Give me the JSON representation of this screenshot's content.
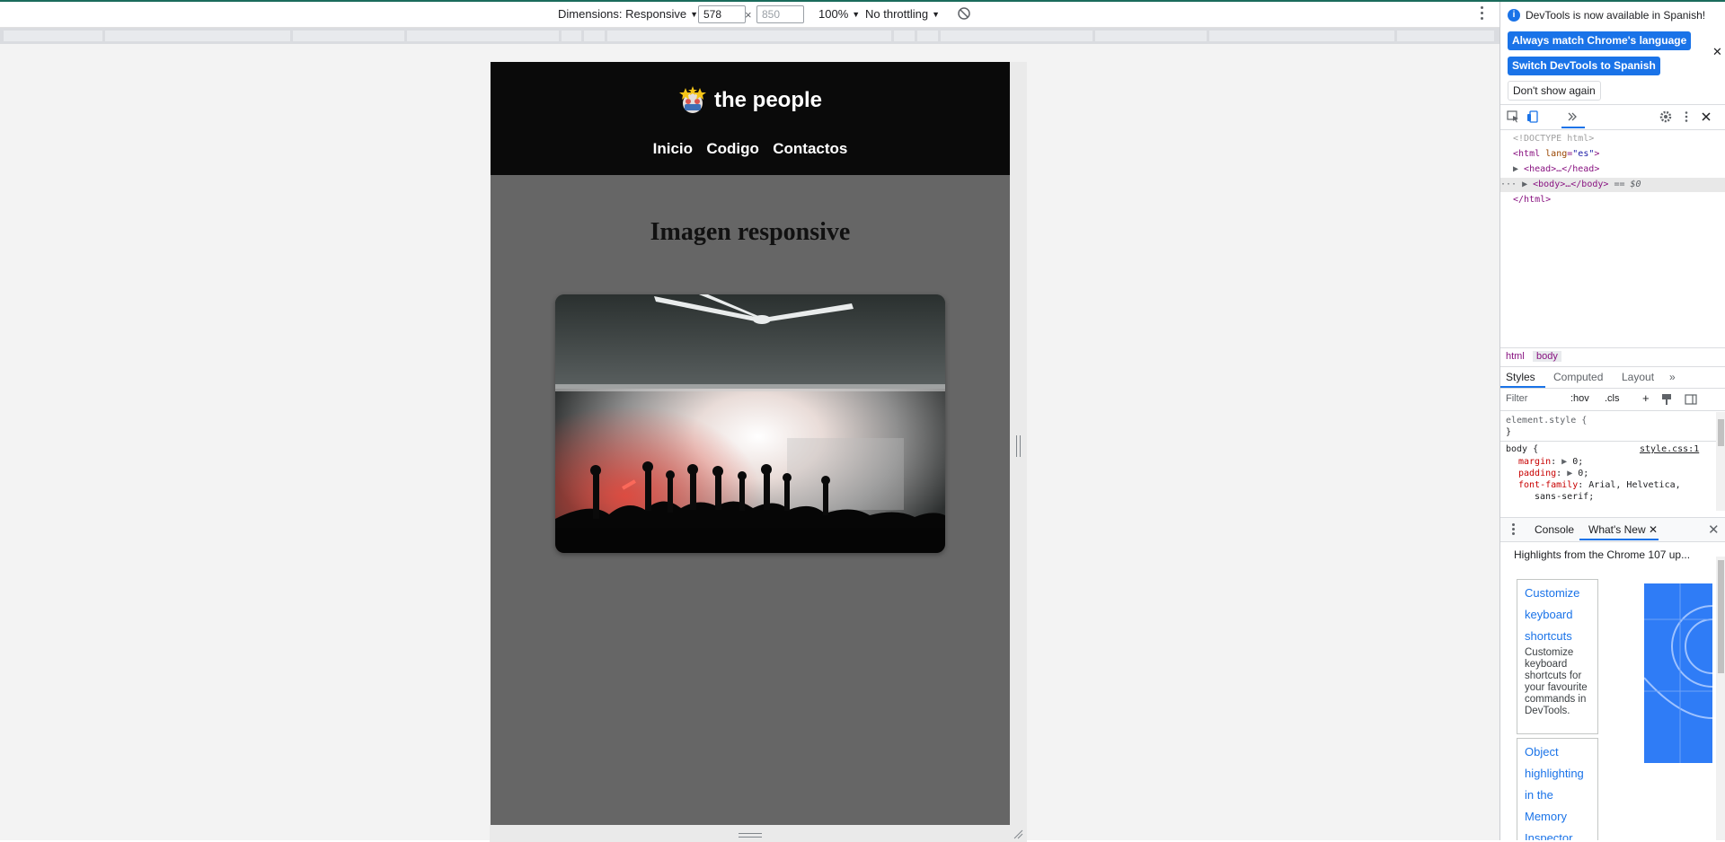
{
  "toolbar": {
    "dimensions_label": "Dimensions: Responsive",
    "width_value": "578",
    "times": "×",
    "height_placeholder": "850",
    "zoom": "100%",
    "throttling": "No throttling"
  },
  "site": {
    "brand": "the people",
    "nav": [
      "Inicio",
      "Codigo",
      "Contactos"
    ],
    "heading": "Imagen responsive"
  },
  "devtools": {
    "info_message": "DevTools is now available in Spanish!",
    "btn_match_language": "Always match Chrome's language",
    "btn_switch_spanish": "Switch DevTools to Spanish",
    "btn_dont_show": "Don't show again",
    "dom": {
      "doctype": "<!DOCTYPE html>",
      "html_open_tag": "html",
      "html_attr_name": "lang",
      "html_attr_value": "\"es\"",
      "head": "<head>…</head>",
      "body": "<body>…</body>",
      "body_suffix": "== $0",
      "html_close": "</html>",
      "ellipsis": "···"
    },
    "breadcrumbs": [
      "html",
      "body"
    ],
    "style_tabs": [
      "Styles",
      "Computed",
      "Layout"
    ],
    "filter_placeholder": "Filter",
    "hov": ":hov",
    "cls": ".cls",
    "styles": {
      "element_style": "element.style {",
      "close_brace": "}",
      "body_selector": "body {",
      "source_link": "style.css:1",
      "margin_prop": "margin",
      "margin_val": "0;",
      "padding_prop": "padding",
      "padding_val": "0;",
      "font_prop": "font-family",
      "font_val": "Arial, Helvetica,",
      "font_val2": "sans-serif;"
    },
    "drawer": {
      "console": "Console",
      "whats_new": "What's New",
      "highlights": "Highlights from the Chrome 107 up...",
      "cards": [
        {
          "title": "Customize keyboard shortcuts",
          "desc": "Customize keyboard shortcuts for your favourite commands in DevTools."
        },
        {
          "title": "Object highlighting in the Memory Inspector",
          "desc": ""
        }
      ]
    }
  }
}
